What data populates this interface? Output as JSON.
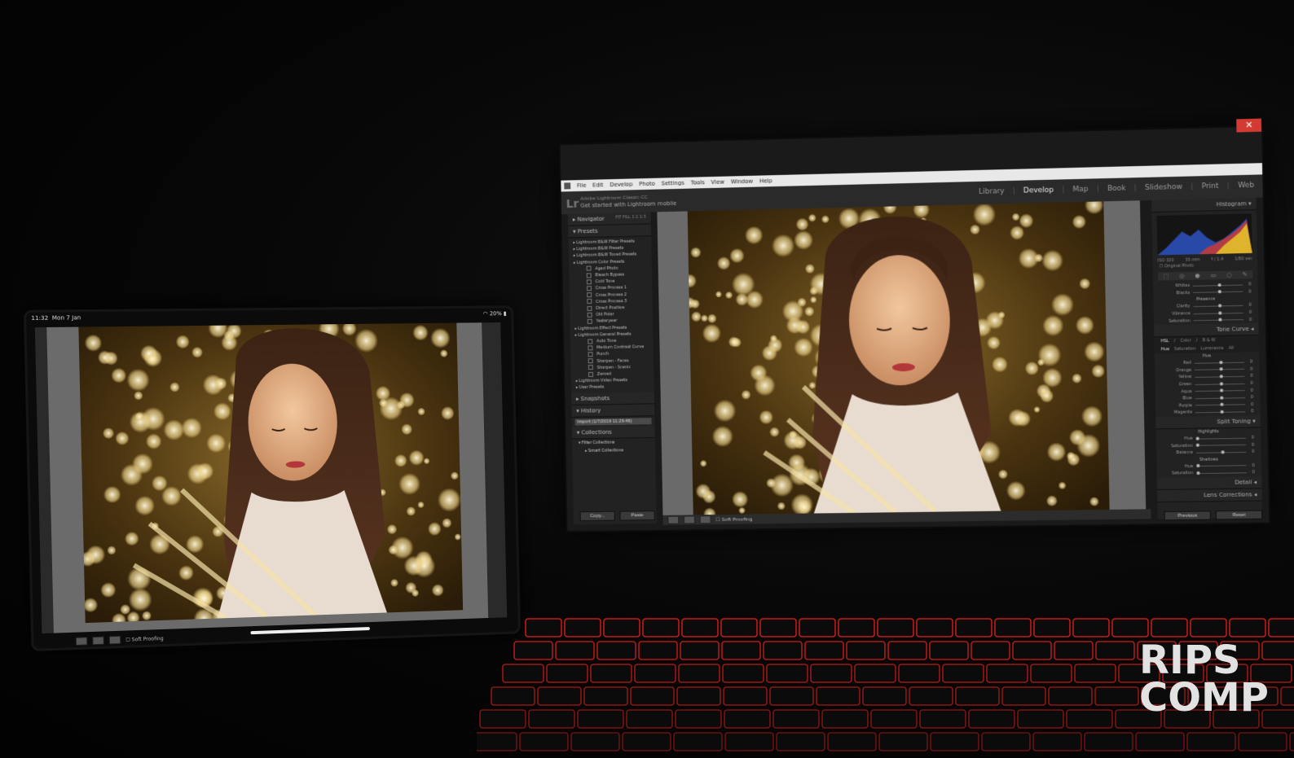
{
  "lightroom": {
    "menu": [
      "File",
      "Edit",
      "Develop",
      "Photo",
      "Settings",
      "Tools",
      "View",
      "Window",
      "Help"
    ],
    "logo": "Lr",
    "identity_top": "Adobe Lightroom Classic CC",
    "identity_bottom": "Get started with Lightroom mobile",
    "modules": [
      "Library",
      "Develop",
      "Map",
      "Book",
      "Slideshow",
      "Print",
      "Web"
    ],
    "active_module": "Develop",
    "close_glyph": "✕",
    "left_panel": {
      "navigator": "Navigator",
      "navigator_zoom": "FIT   FILL   1:1   1:3",
      "presets_header": "Presets",
      "presets": [
        {
          "label": "Lightroom B&W Filter Presets",
          "kind": "folder"
        },
        {
          "label": "Lightroom B&W Presets",
          "kind": "folder"
        },
        {
          "label": "Lightroom B&W Toned Presets",
          "kind": "folder"
        },
        {
          "label": "Lightroom Color Presets",
          "kind": "folder"
        },
        {
          "label": "Aged Photo",
          "kind": "item"
        },
        {
          "label": "Bleach Bypass",
          "kind": "item"
        },
        {
          "label": "Cold Tone",
          "kind": "item"
        },
        {
          "label": "Cross Process 1",
          "kind": "item"
        },
        {
          "label": "Cross Process 2",
          "kind": "item"
        },
        {
          "label": "Cross Process 3",
          "kind": "item"
        },
        {
          "label": "Direct Positive",
          "kind": "item"
        },
        {
          "label": "Old Polar",
          "kind": "item"
        },
        {
          "label": "Yesteryear",
          "kind": "item"
        },
        {
          "label": "Lightroom Effect Presets",
          "kind": "folder"
        },
        {
          "label": "Lightroom General Presets",
          "kind": "folder"
        },
        {
          "label": "Auto Tone",
          "kind": "item"
        },
        {
          "label": "Medium Contrast Curve",
          "kind": "item"
        },
        {
          "label": "Punch",
          "kind": "item"
        },
        {
          "label": "Sharpen - Faces",
          "kind": "item"
        },
        {
          "label": "Sharpen - Scenic",
          "kind": "item"
        },
        {
          "label": "Zeroed",
          "kind": "item"
        },
        {
          "label": "Lightroom Video Presets",
          "kind": "folder"
        },
        {
          "label": "User Presets",
          "kind": "folder"
        }
      ],
      "snapshots": "Snapshots",
      "history": "History",
      "history_item": "Import (1/7/2019 11:29:46)",
      "collections": "Collections",
      "filter_collections": "Filter Collections",
      "smart_collections": "Smart Collections",
      "copy": "Copy...",
      "paste": "Paste"
    },
    "toolbar": {
      "soft_proofing": "Soft Proofing"
    },
    "right_panel": {
      "histogram": "Histogram",
      "iso": "ISO 320",
      "focal": "35 mm",
      "aperture": "f / 1.4",
      "shutter": "1/80 sec",
      "original_photo": "Original Photo",
      "basic_sliders": [
        {
          "label": "Whites",
          "value": "0",
          "pos": 0.5
        },
        {
          "label": "Blacks",
          "value": "0",
          "pos": 0.5
        }
      ],
      "presence": "Presence",
      "presence_sliders": [
        {
          "label": "Clarity",
          "value": "0",
          "pos": 0.5
        },
        {
          "label": "Vibrance",
          "value": "0",
          "pos": 0.5
        },
        {
          "label": "Saturation",
          "value": "0",
          "pos": 0.5
        }
      ],
      "tone_curve": "Tone Curve",
      "hsl_tabs": [
        "HSL",
        "Color",
        "B & W"
      ],
      "hsl_subtabs": [
        "Hue",
        "Saturation",
        "Luminance",
        "All"
      ],
      "hue_header": "Hue",
      "hue_sliders": [
        {
          "label": "Red",
          "value": "0",
          "pos": 0.5
        },
        {
          "label": "Orange",
          "value": "0",
          "pos": 0.5
        },
        {
          "label": "Yellow",
          "value": "0",
          "pos": 0.5
        },
        {
          "label": "Green",
          "value": "0",
          "pos": 0.5
        },
        {
          "label": "Aqua",
          "value": "0",
          "pos": 0.5
        },
        {
          "label": "Blue",
          "value": "0",
          "pos": 0.5
        },
        {
          "label": "Purple",
          "value": "0",
          "pos": 0.5
        },
        {
          "label": "Magenta",
          "value": "0",
          "pos": 0.5
        }
      ],
      "split_toning": "Split Toning",
      "highlights": "Highlights",
      "highlight_sliders": [
        {
          "label": "Hue",
          "value": "0",
          "pos": 0.0
        },
        {
          "label": "Saturation",
          "value": "0",
          "pos": 0.0
        }
      ],
      "balance": {
        "label": "Balance",
        "value": "0",
        "pos": 0.5
      },
      "shadows": "Shadows",
      "shadow_sliders": [
        {
          "label": "Hue",
          "value": "0",
          "pos": 0.0
        },
        {
          "label": "Saturation",
          "value": "0",
          "pos": 0.0
        }
      ],
      "detail": "Detail",
      "lens_corrections": "Lens Corrections",
      "previous": "Previous",
      "reset": "Reset"
    }
  },
  "tablet": {
    "time": "11:32",
    "date": "Mon 7 Jan",
    "battery": "20%",
    "soft_proofing": "Soft Proofing"
  },
  "watermark": {
    "line1": "RIPS",
    "line2": "COMP"
  },
  "colors": {
    "close_button": "#d23a32",
    "keyboard_backlight": "#e0201c",
    "bokeh_gold": "#e8c874",
    "panel_bg": "#222222"
  }
}
